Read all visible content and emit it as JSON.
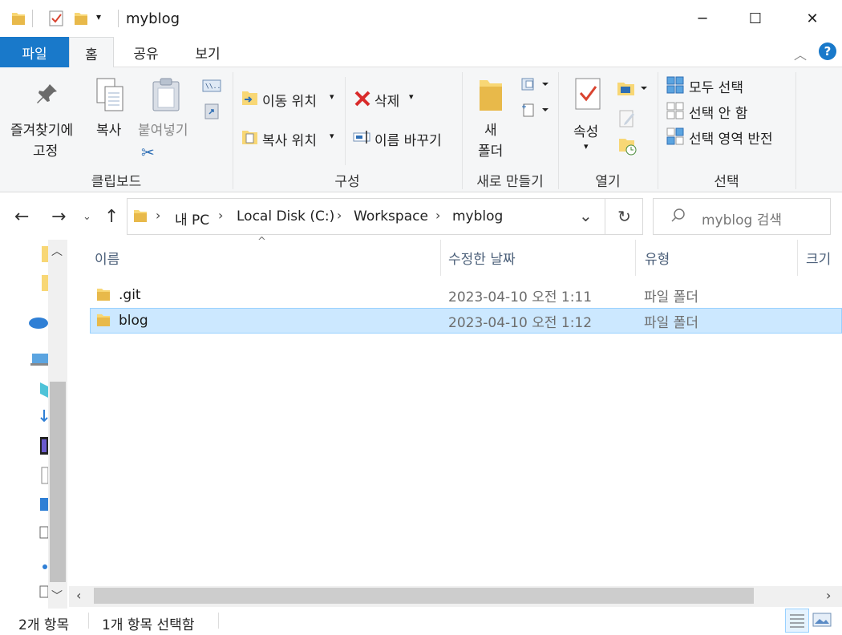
{
  "window": {
    "title": "myblog",
    "minimize": "─",
    "maximize": "☐",
    "close": "✕"
  },
  "tabs": {
    "file": "파일",
    "home": "홈",
    "share": "공유",
    "view": "보기"
  },
  "ribbon": {
    "pin_line1": "즐겨찾기에",
    "pin_line2": "고정",
    "copy": "복사",
    "paste": "붙여넣기",
    "group_clipboard": "클립보드",
    "move_to": "이동 위치",
    "copy_to": "복사 위치",
    "delete": "삭제",
    "rename": "이름 바꾸기",
    "group_organize": "구성",
    "new_folder_line1": "새",
    "new_folder_line2": "폴더",
    "group_new": "새로 만들기",
    "properties": "속성",
    "group_open": "열기",
    "select_all": "모두 선택",
    "select_none": "선택 안 함",
    "invert_selection": "선택 영역 반전",
    "group_select": "선택"
  },
  "address": {
    "crumbs": [
      "내 PC",
      "Local Disk (C:)",
      "Workspace",
      "myblog"
    ],
    "search_placeholder": "myblog 검색"
  },
  "columns": {
    "name": "이름",
    "modified": "수정한 날짜",
    "type": "유형",
    "size": "크기"
  },
  "files": [
    {
      "name": ".git",
      "modified": "2023-04-10 오전 1:11",
      "type": "파일 폴더",
      "selected": false
    },
    {
      "name": "blog",
      "modified": "2023-04-10 오전 1:12",
      "type": "파일 폴더",
      "selected": true
    }
  ],
  "status": {
    "count": "2개 항목",
    "selected": "1개 항목 선택함"
  },
  "colors": {
    "accent": "#1979ca",
    "selection": "#cce8ff",
    "folder": "#f8d775"
  }
}
